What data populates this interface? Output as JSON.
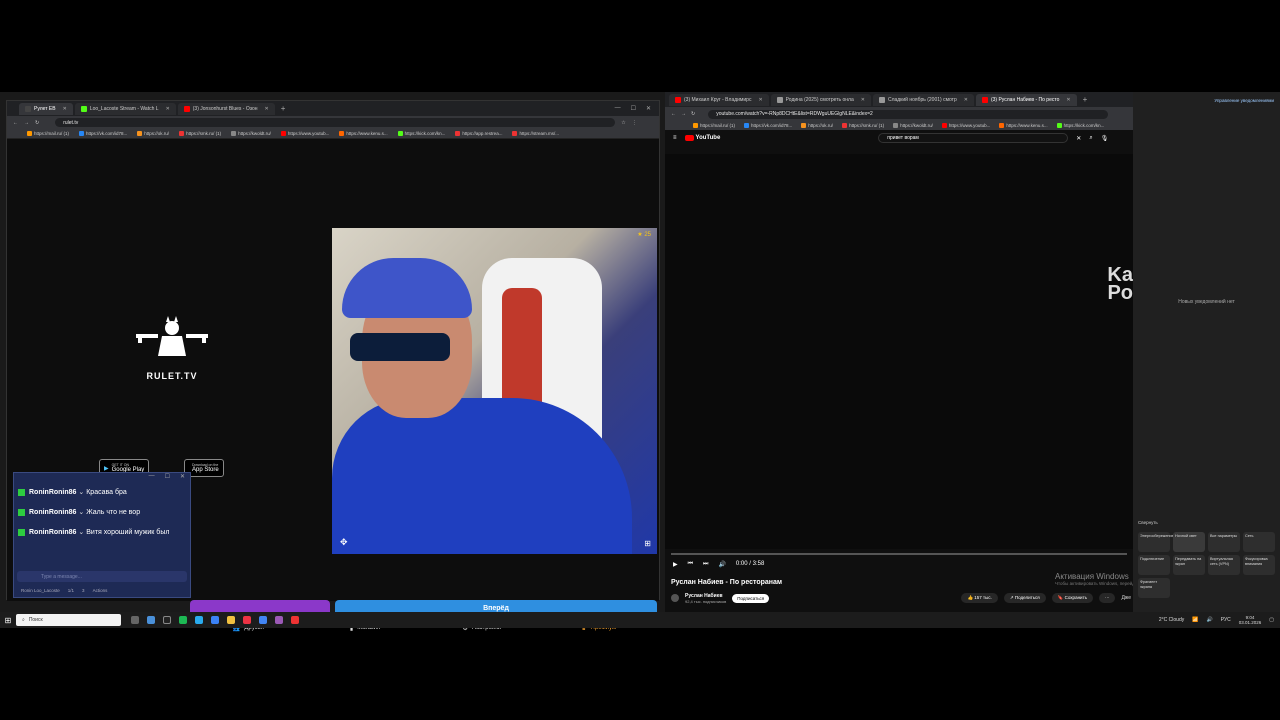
{
  "left_browser": {
    "tabs": [
      {
        "label": "Рулет ЕВ",
        "active": true
      },
      {
        "label": "Loo_Lacoste Stream - Watch L",
        "active": false
      },
      {
        "label": "(3) Jonsonhurst Blues - Озон",
        "active": false
      }
    ],
    "url": "rulet.tv",
    "bookmarks": [
      "https://mail.ru/ (1)",
      "https://vk.com/id78...",
      "https://ok.ru/",
      "https://smk.ru/ (1)",
      "https://kwoldt.ru/",
      "https://www.youtub...",
      "https://www.kenu.s...",
      "https://kick.com/kn...",
      "https://app.restrea...",
      "https://stream.ms/..."
    ]
  },
  "rulet": {
    "brand": "RULET.TV",
    "google_play_small": "GET IT ON",
    "google_play": "Google Play",
    "app_store_small": "Download on the",
    "app_store": "App Store",
    "rating": "25",
    "next_button": "Вперёд",
    "nav": [
      {
        "label": "Друзья",
        "icon": "friends-icon"
      },
      {
        "label": "Магазин",
        "icon": "shop-icon"
      },
      {
        "label": "Настройки",
        "icon": "gear-icon"
      },
      {
        "label": "Премиум",
        "icon": "crown-icon"
      }
    ]
  },
  "chat": {
    "messages": [
      {
        "nick": "RoninRonin86",
        "text": "Красава бра"
      },
      {
        "nick": "RoninRonin86",
        "text": "Жаль что не вор"
      },
      {
        "nick": "RoninRonin86",
        "text": "Витя хороший мужик был"
      }
    ],
    "input_placeholder": "Type a message...",
    "footer": [
      "Ronin Loo_Lacoste",
      "1/1",
      "3",
      "Actions"
    ]
  },
  "right_browser": {
    "tabs": [
      {
        "label": "(3) Михаил Круг - Владимирс",
        "active": false
      },
      {
        "label": "Родина (2025) смотреть онла",
        "active": false
      },
      {
        "label": "Сладкий ноябрь (2001) смотр",
        "active": false
      },
      {
        "label": "(3) Руслан Набиев - По ресто",
        "active": true
      }
    ],
    "url": "youtube.com/watch?v=-RNp8DCHtE&list=RDWguUEGlgNLE&index=2",
    "bookmarks": [
      "https://mail.ru/ (1)",
      "https://vk.com/id78...",
      "https://ok.ru/",
      "https://smk.ru/ (1)",
      "https://kwoldt.ru/",
      "https://www.youtub...",
      "https://www.kenu.s...",
      "https://kick.com/kn..."
    ]
  },
  "youtube": {
    "logo": "YouTube",
    "search_value": "привет ворам",
    "overlay_text_1": "Ka",
    "overlay_text_2": "Po",
    "time": "0:00 / 3:58",
    "video_title": "Руслан Набиев - По ресторанам",
    "channel": "Руслан Набиев",
    "subscribers": "92,4 тыс. подписчиков",
    "subscribe_label": "Подписаться",
    "likes": "157 тыс.",
    "share_label": "Поделиться",
    "save_label": "Сохранить",
    "more_label": "Дже"
  },
  "activation": {
    "title": "Активация Windows",
    "subtitle": "Чтобы активировать Windows, перейдите в раздел \"Параметры\"."
  },
  "notifications": {
    "manage": "Управление уведомлениями",
    "none": "Новых уведомлений нет",
    "collapse": "Свернуть",
    "tiles": [
      "Энергосбережение",
      "Ночной свет",
      "Все параметры",
      "Сеть",
      "Подключение",
      "Передавать на экран",
      "Виртуальная сеть (VPN)",
      "Фокусировка внимания",
      "Фрагмент экрана"
    ]
  },
  "taskbar": {
    "search": "Поиск",
    "weather": "2°C Cloudy",
    "lang": "РУС",
    "time": "9:04",
    "date": "03.01.2026"
  }
}
